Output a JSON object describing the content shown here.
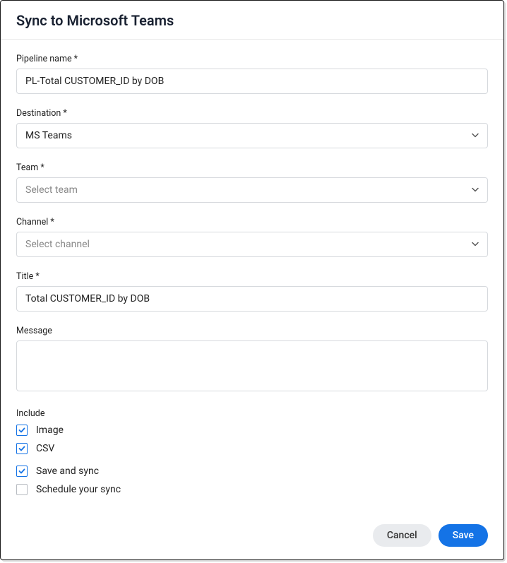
{
  "header": {
    "title": "Sync to Microsoft Teams"
  },
  "form": {
    "pipeline": {
      "label": "Pipeline name *",
      "value": "PL-Total CUSTOMER_ID by DOB"
    },
    "destination": {
      "label": "Destination *",
      "value": "MS Teams"
    },
    "team": {
      "label": "Team *",
      "placeholder": "Select team"
    },
    "channel": {
      "label": "Channel *",
      "placeholder": "Select channel"
    },
    "title_field": {
      "label": "Title *",
      "value": "Total CUSTOMER_ID by DOB"
    },
    "message": {
      "label": "Message"
    },
    "include": {
      "heading": "Include",
      "image": "Image",
      "csv": "CSV",
      "save_sync": "Save and sync",
      "schedule": "Schedule your sync"
    }
  },
  "footer": {
    "cancel": "Cancel",
    "save": "Save"
  }
}
